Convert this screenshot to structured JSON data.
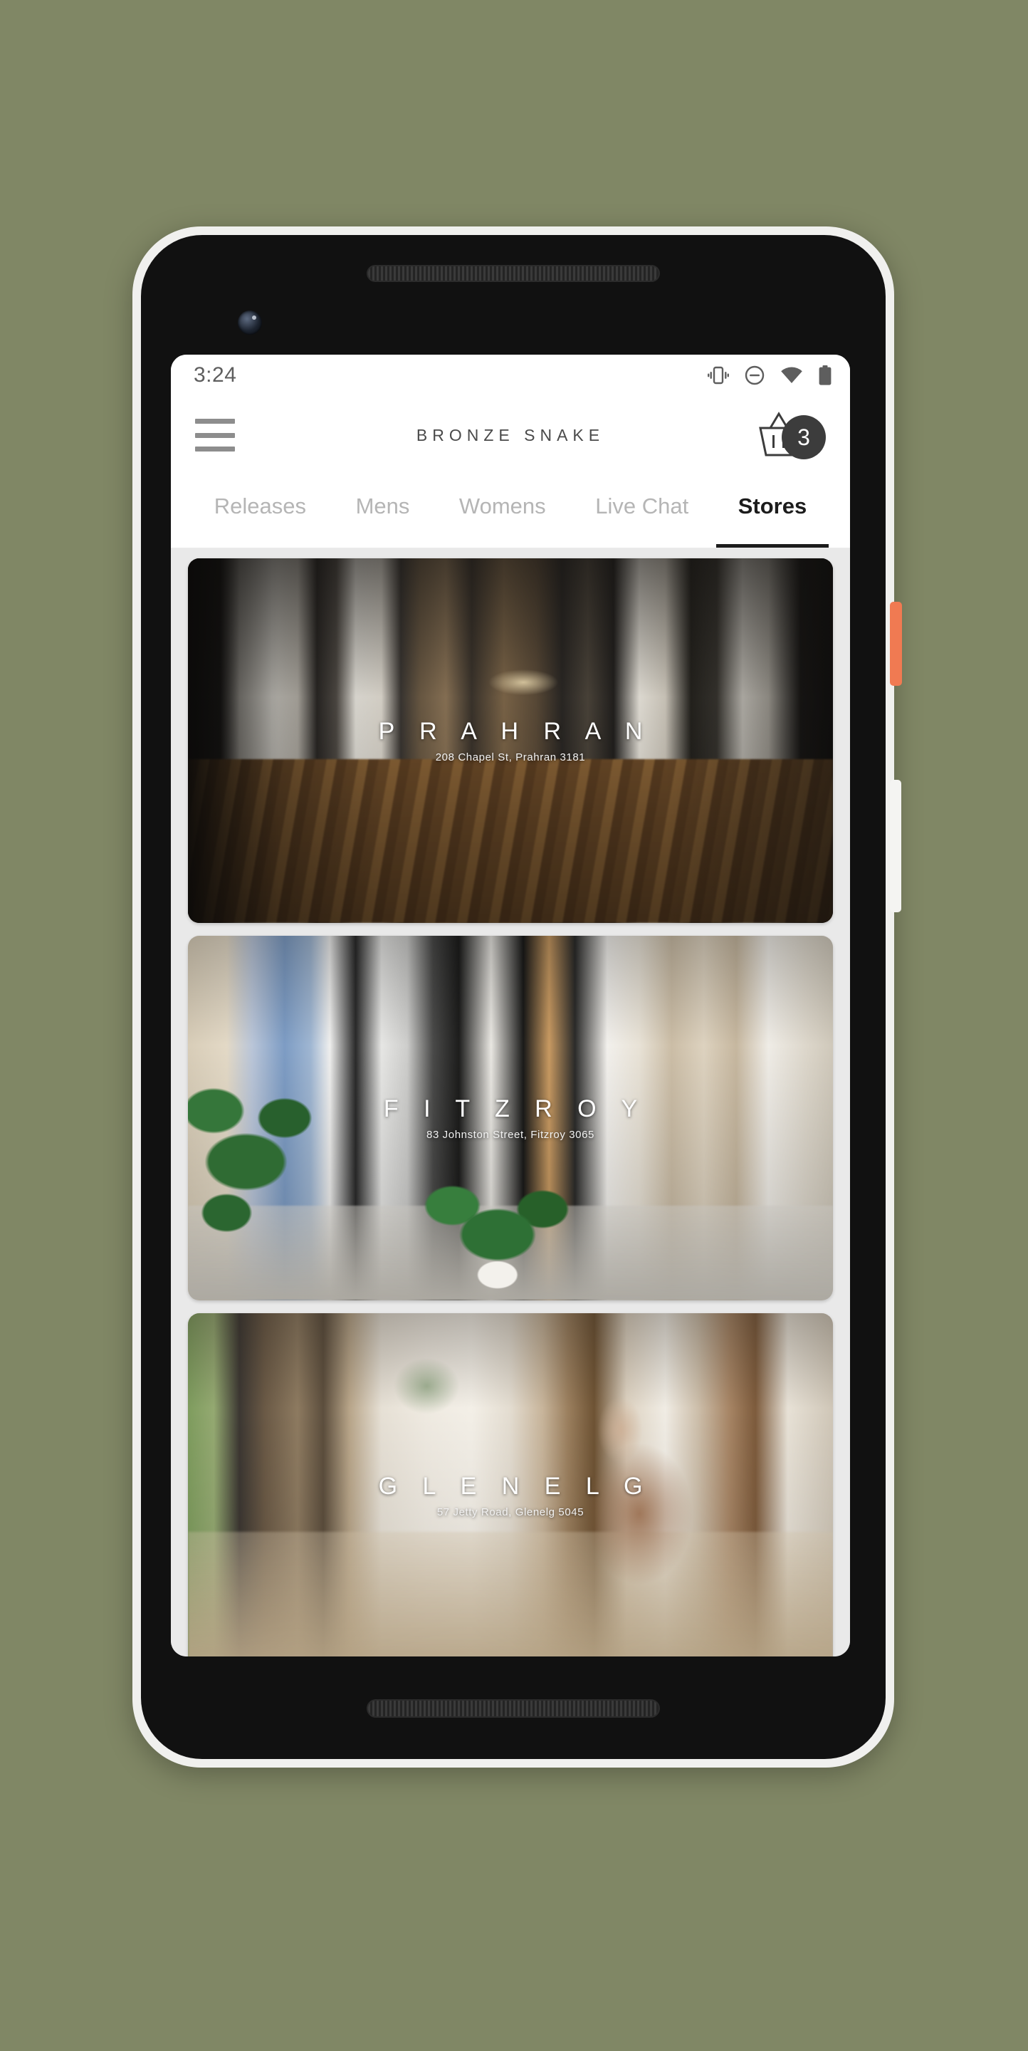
{
  "status_bar": {
    "time": "3:24",
    "icons": [
      "vibrate-icon",
      "do-not-disturb-icon",
      "wifi-icon",
      "battery-icon"
    ]
  },
  "app_bar": {
    "menu_icon": "hamburger-menu-icon",
    "brand_title": "BRONZE SNAKE",
    "cart_icon": "shopping-basket-icon",
    "cart_count": "3"
  },
  "tabs": [
    {
      "label": "Releases",
      "active": false
    },
    {
      "label": "Mens",
      "active": false
    },
    {
      "label": "Womens",
      "active": false
    },
    {
      "label": "Live Chat",
      "active": false
    },
    {
      "label": "Stores",
      "active": true
    }
  ],
  "stores": [
    {
      "name": "P R A H R A N",
      "address": "208 Chapel St, Prahran 3181"
    },
    {
      "name": "F I T Z R O Y",
      "address": "83 Johnston Street, Fitzroy 3065"
    },
    {
      "name": "G L E N E L G",
      "address": "57 Jetty Road, Glenelg 5045"
    }
  ],
  "device": {
    "power_button": "power-button",
    "volume_button": "volume-button",
    "power_button_color": "#f07a52"
  },
  "colors": {
    "page_background": "#808765",
    "list_background": "#e9e9e9",
    "accent_dark": "#1c1c1c",
    "tab_inactive": "#b5b5b5",
    "badge_background": "#3c3c3c"
  }
}
